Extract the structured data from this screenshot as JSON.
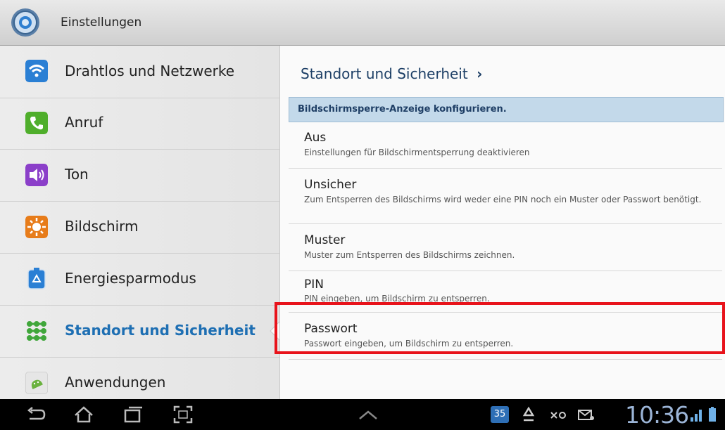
{
  "header": {
    "title": "Einstellungen"
  },
  "sidebar": {
    "items": [
      {
        "label": "Drahtlos und Netzwerke"
      },
      {
        "label": "Anruf"
      },
      {
        "label": "Ton"
      },
      {
        "label": "Bildschirm"
      },
      {
        "label": "Energiesparmodus"
      },
      {
        "label": "Standort und Sicherheit"
      },
      {
        "label": "Anwendungen"
      }
    ]
  },
  "panel": {
    "breadcrumb": "Standort und Sicherheit",
    "breadcrumb_chevron": "›",
    "section_title": "Bildschirmsperre-Anzeige konfigurieren.",
    "options": [
      {
        "title": "Aus",
        "desc": "Einstellungen für Bildschirmentsperrung deaktivieren"
      },
      {
        "title": "Unsicher",
        "desc": "Zum Entsperren des Bildschirms wird weder eine PIN noch ein Muster oder Passwort benötigt."
      },
      {
        "title": "Muster",
        "desc": "Muster zum Entsperren des Bildschirms zeichnen."
      },
      {
        "title": "PIN",
        "desc": "PIN eingeben, um Bildschirm zu entsperren."
      },
      {
        "title": "Passwort",
        "desc": "Passwort eingeben, um Bildschirm zu entsperren."
      }
    ]
  },
  "statusbar": {
    "calendar_day": "35",
    "time": "10:36"
  },
  "colors": {
    "accent": "#1e6fb3",
    "highlight": "#e8131b",
    "section_bar": "#c3d9ea"
  }
}
